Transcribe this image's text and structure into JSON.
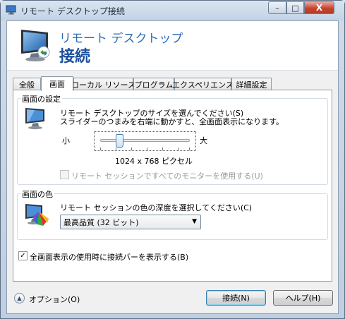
{
  "window": {
    "title": "リモート デスクトップ接続",
    "controls": {
      "minimize": "–",
      "maximize": "□",
      "close": "X"
    }
  },
  "header": {
    "subtitle": "リモート デスクトップ",
    "title": "接続",
    "icon": "remote-desktop-monitor-icon"
  },
  "tabs": [
    {
      "label": "全般",
      "active": false
    },
    {
      "label": "画面",
      "active": true
    },
    {
      "label": "ローカル リソース",
      "active": false
    },
    {
      "label": "プログラム",
      "active": false
    },
    {
      "label": "エクスペリエンス",
      "active": false
    },
    {
      "label": "詳細設定",
      "active": false
    }
  ],
  "display_settings": {
    "group_label": "画面の設定",
    "icon": "monitor-icon",
    "description_line1": "リモート デスクトップのサイズを選んでください(S)",
    "description_line2": "スライダーのつまみを右端に動かすと、全画面表示になります。",
    "slider_min_label": "小",
    "slider_max_label": "大",
    "slider_level": 0.22,
    "resolution_text": "1024 x 768 ピクセル",
    "all_monitors_label": "リモート セッションですべてのモニターを使用する(U)",
    "all_monitors_checked": false,
    "all_monitors_enabled": false
  },
  "colors": {
    "group_label": "画面の色",
    "icon": "color-palette-icon",
    "description": "リモート セッションの色の深度を選択してください(C)",
    "selected": "最高品質 (32 ビット)",
    "dropdown_arrow": "▼"
  },
  "connection_bar": {
    "label": "全画面表示の使用時に接続バーを表示する(B)",
    "checked": true,
    "check_mark": "✓"
  },
  "footer": {
    "options_label": "オプション(O)",
    "options_icon": "chevron-up-icon",
    "connect_button": "接続(N)",
    "help_button": "ヘルプ(H)"
  },
  "theme": {
    "accent": "#1b4f9c",
    "accent_light": "#2c6cb8",
    "close_red": "#c7432b"
  }
}
